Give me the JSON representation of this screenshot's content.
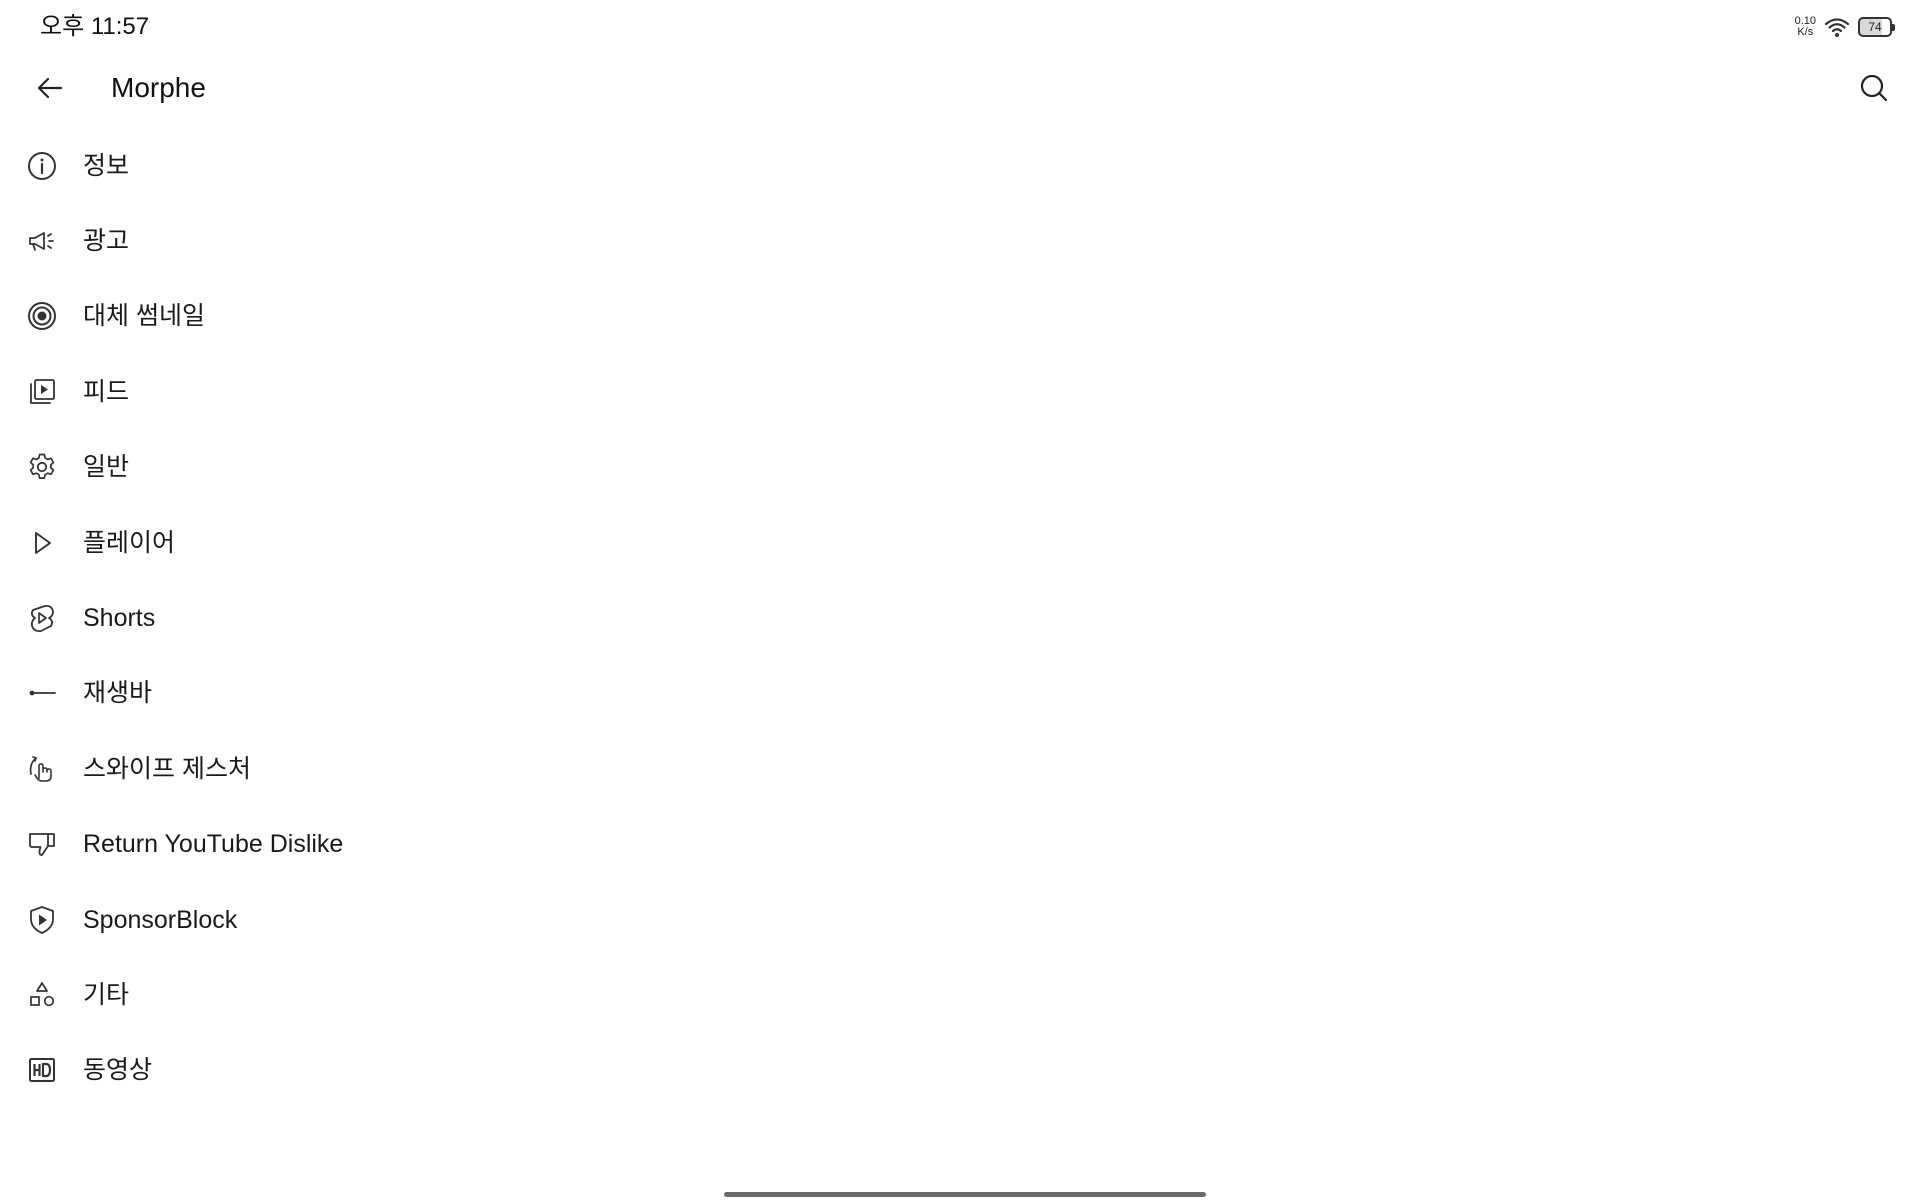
{
  "status_bar": {
    "time": "오후 11:57",
    "net_speed_value": "0.10",
    "net_speed_unit": "K/s",
    "battery_level": "74",
    "battery_level_fraction": 0.74,
    "icons": [
      "network-speed",
      "wifi-icon",
      "battery-icon"
    ]
  },
  "app_bar": {
    "title": "Morphe",
    "back_icon": "arrow-back-icon",
    "search_icon": "search-icon"
  },
  "menu": {
    "items": [
      {
        "label": "정보",
        "icon": "info-icon"
      },
      {
        "label": "광고",
        "icon": "megaphone-icon"
      },
      {
        "label": "대체 썸네일",
        "icon": "target-icon"
      },
      {
        "label": "피드",
        "icon": "feed-playlist-icon"
      },
      {
        "label": "일반",
        "icon": "gear-icon"
      },
      {
        "label": "플레이어",
        "icon": "play-icon"
      },
      {
        "label": "Shorts",
        "icon": "shorts-icon"
      },
      {
        "label": "재생바",
        "icon": "seekbar-icon"
      },
      {
        "label": "스와이프 제스처",
        "icon": "swipe-gesture-icon"
      },
      {
        "label": "Return YouTube Dislike",
        "icon": "thumbs-down-icon"
      },
      {
        "label": "SponsorBlock",
        "icon": "shield-play-icon"
      },
      {
        "label": "기타",
        "icon": "shapes-icon"
      },
      {
        "label": "동영상",
        "icon": "hd-icon"
      }
    ]
  },
  "colors": {
    "background": "#ffffff",
    "text": "#1a1a1a",
    "icon": "#333333",
    "nav_handle": "#6b6b6b"
  }
}
